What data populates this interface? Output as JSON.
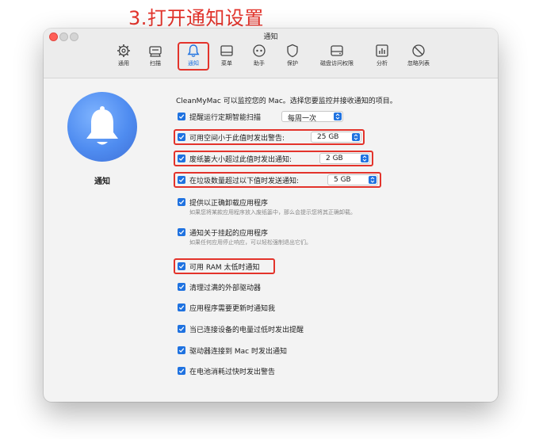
{
  "caption": "3.打开通知设置",
  "window": {
    "title": "通知",
    "toolbar": [
      {
        "label": "通用",
        "icon": "gear-icon"
      },
      {
        "label": "扫描",
        "icon": "scan-icon"
      },
      {
        "label": "通知",
        "icon": "bell-icon",
        "active": true
      },
      {
        "label": "菜单",
        "icon": "menu-icon"
      },
      {
        "label": "助手",
        "icon": "assistant-icon"
      },
      {
        "label": "保护",
        "icon": "shield-icon"
      },
      {
        "label": "磁盘访问权限",
        "icon": "disk-icon"
      },
      {
        "label": "分析",
        "icon": "analytics-icon"
      },
      {
        "label": "忽略列表",
        "icon": "ignore-icon"
      }
    ]
  },
  "sidebar": {
    "title": "通知",
    "icon": "bell-icon"
  },
  "content": {
    "intro": "CleanMyMac 可以监控您的 Mac。选择您要监控并接收通知的项目。",
    "options": [
      {
        "label": "提醒运行定期智能扫描",
        "checked": true,
        "select": "每周一次"
      },
      {
        "label": "可用空间小于此值时发出警告:",
        "checked": true,
        "select": "25 GB"
      },
      {
        "label": "废纸篓大小超过此值时发出通知:",
        "checked": true,
        "select": "2 GB"
      },
      {
        "label": "在垃圾数量超过以下值时发送通知:",
        "checked": true,
        "select": "5 GB"
      },
      {
        "label": "提供以正确卸载应用程序",
        "checked": true,
        "sub": "如果您将某款应用程序放入废纸篓中，那么会提示您将其正确卸载。"
      },
      {
        "label": "通知关于挂起的应用程序",
        "checked": true,
        "sub": "如果任何应用停止响应，可以轻松强制退出它们。"
      },
      {
        "label": "可用 RAM 太低时通知",
        "checked": true
      },
      {
        "label": "清理过满的外部驱动器",
        "checked": true
      },
      {
        "label": "应用程序需要更新时通知我",
        "checked": true
      },
      {
        "label": "当已连接设备的电量过低时发出提醒",
        "checked": true
      },
      {
        "label": "驱动器连接到 Mac 时发出通知",
        "checked": true
      },
      {
        "label": "在电池消耗过快时发出警告",
        "checked": true
      }
    ]
  },
  "colors": {
    "accent": "#1f72e0",
    "highlight": "#e3332b"
  }
}
